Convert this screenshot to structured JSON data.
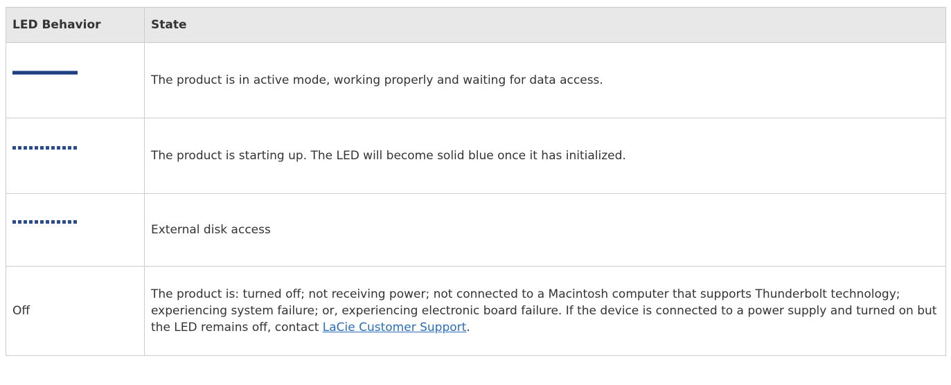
{
  "table": {
    "headers": {
      "behavior": "LED Behavior",
      "state": "State"
    },
    "rows": [
      {
        "behavior_icon": "solid-blue-led-icon",
        "state": "The product is in active mode, working properly and waiting for data access."
      },
      {
        "behavior_icon": "blinking-blue-led-icon",
        "state": "The product is starting up. The LED will become solid blue once it has initialized."
      },
      {
        "behavior_icon": "blinking-blue-led-icon",
        "state": "External disk access"
      },
      {
        "behavior": "Off",
        "state_before_link": "The product is: turned off; not receiving power; not connected to a Macintosh computer that supports Thunderbolt technology; experiencing system failure; or, experiencing electronic board failure. If the device is connected to a power supply and turned on but the LED remains off, contact ",
        "link_text": "LaCie Customer Support",
        "state_after_link": "."
      }
    ]
  },
  "colors": {
    "led_blue": "#1f3f7f",
    "link": "#2a6ebb",
    "header_bg": "#e8e8e8",
    "border": "#cccccc"
  }
}
